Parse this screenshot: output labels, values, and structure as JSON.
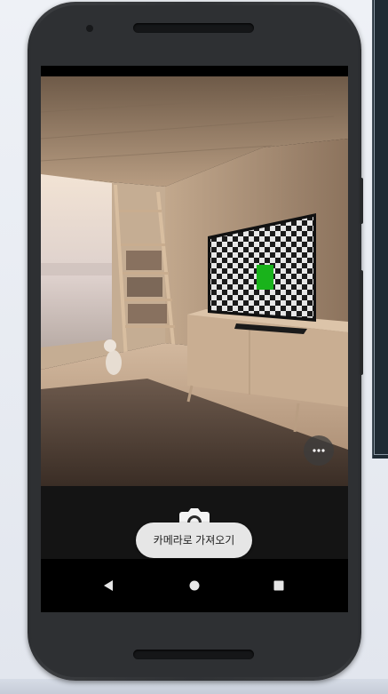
{
  "app": {
    "toast_text": "카메라로 가져오기"
  },
  "icons": {
    "camera": "camera-icon",
    "more": "more-horizontal-icon",
    "back": "nav-back-icon",
    "home": "nav-home-icon",
    "recents": "nav-recents-icon"
  },
  "colors": {
    "tv_marker": "#19b31b",
    "toast_bg": "#e6e6e6",
    "screen_bg": "#000000"
  }
}
